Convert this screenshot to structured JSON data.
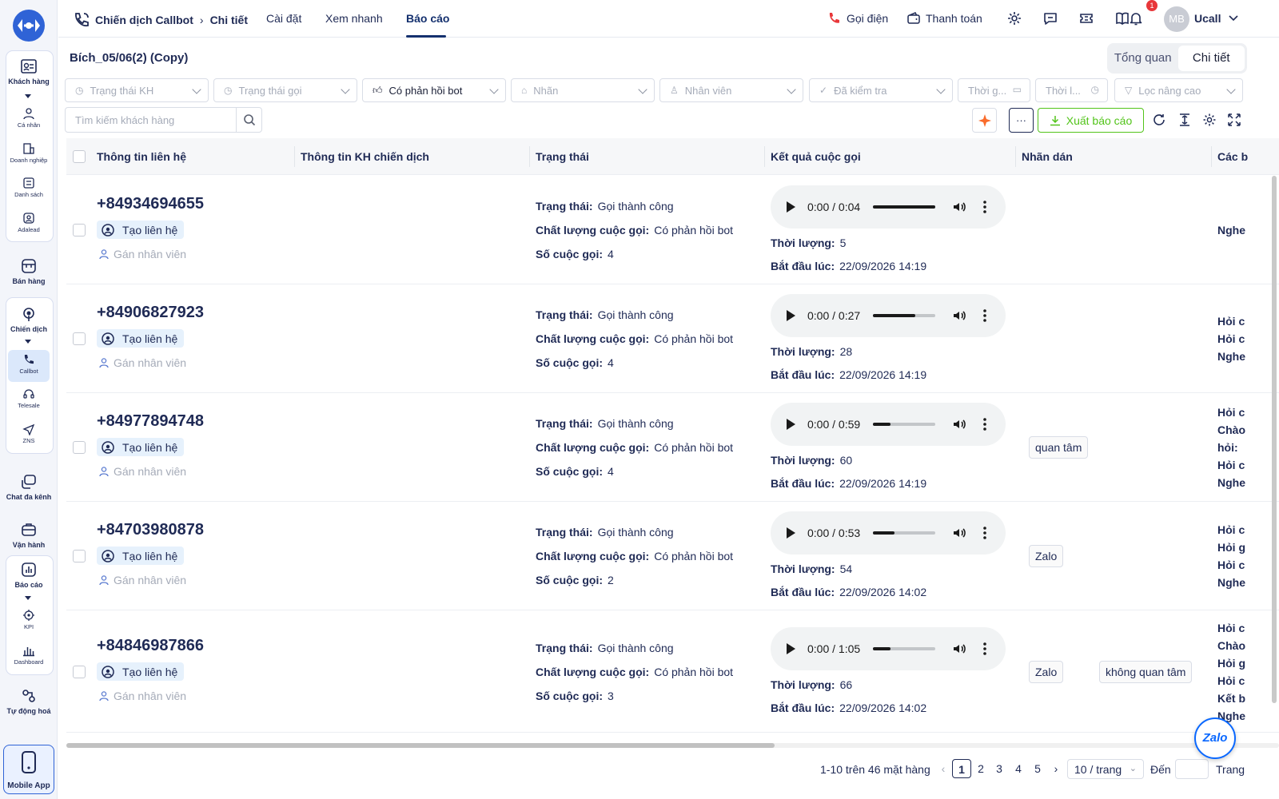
{
  "sidebar": {
    "items": [
      {
        "label": "Khách hàng",
        "icon": "contact-card-icon"
      },
      {
        "label": "Cá nhân",
        "icon": "people-icon"
      },
      {
        "label": "Doanh nghiệp",
        "icon": "building-icon"
      },
      {
        "label": "Danh sách",
        "icon": "list-icon"
      },
      {
        "label": "Adalead",
        "icon": "user-circle-icon"
      },
      {
        "label": "Bán hàng",
        "icon": "store-icon"
      },
      {
        "label": "Chiến dịch",
        "icon": "broadcast-icon"
      },
      {
        "label": "Callbot",
        "icon": "phone-icon"
      },
      {
        "label": "Telesale",
        "icon": "headset-icon"
      },
      {
        "label": "ZNS",
        "icon": "send-icon"
      },
      {
        "label": "Chat đa kênh",
        "icon": "chat-icon"
      },
      {
        "label": "Vận hành",
        "icon": "briefcase-icon"
      },
      {
        "label": "Báo cáo",
        "icon": "chart-icon"
      },
      {
        "label": "KPI",
        "icon": "target-icon"
      },
      {
        "label": "Dashboard",
        "icon": "bars-icon"
      },
      {
        "label": "Tự động hoá",
        "icon": "automation-icon"
      }
    ],
    "mobile_app": "Mobile App"
  },
  "header": {
    "breadcrumb_root": "Chiến dịch Callbot",
    "breadcrumb_current": "Chi tiết",
    "tabs": [
      "Cài đặt",
      "Xem nhanh",
      "Báo cáo"
    ],
    "active_tab": "Báo cáo",
    "call_label": "Gọi điện",
    "pay_label": "Thanh toán",
    "notification_count": "1",
    "avatar_initials": "MB",
    "user_name": "Ucall"
  },
  "page": {
    "title": "Bích_05/06(2) (Copy)",
    "view_toggle": [
      "Tổng quan",
      "Chi tiết"
    ],
    "active_view": "Chi tiết"
  },
  "filters": [
    {
      "label": "Trạng thái KH",
      "placeholder": true
    },
    {
      "label": "Trạng thái gọi",
      "placeholder": true
    },
    {
      "label": "Có phản hồi bot",
      "placeholder": false
    },
    {
      "label": "Nhãn",
      "placeholder": true
    },
    {
      "label": "Nhân viên",
      "placeholder": true
    },
    {
      "label": "Đã kiểm tra",
      "placeholder": true
    },
    {
      "label": "Thời g...",
      "placeholder": true
    },
    {
      "label": "Thời l...",
      "placeholder": true
    },
    {
      "label": "Lọc nâng cao",
      "placeholder": true
    }
  ],
  "toolbar": {
    "search_placeholder": "Tìm kiếm khách hàng",
    "more_label": "···",
    "export_label": "Xuất báo cáo"
  },
  "table": {
    "columns": [
      "Thông tin liên hệ",
      "Thông tin KH chiến dịch",
      "Trạng thái",
      "Kết quả cuộc gọi",
      "Nhãn dán",
      "Các b"
    ],
    "labels": {
      "status": "Trạng thái:",
      "quality": "Chất lượng cuộc gọi:",
      "calls": "Số cuộc gọi:",
      "duration": "Thời lượng:",
      "started": "Bắt đầu lúc:",
      "create_contact": "Tạo liên hệ",
      "assign_staff": "Gán nhân viên"
    },
    "rows": [
      {
        "phone": "+84934694655",
        "status": "Gọi thành công",
        "quality": "Có phản hồi bot",
        "calls": "4",
        "audio_time": "0:00 / 0:04",
        "progress": 1.0,
        "duration": "5",
        "started": "22/09/2026 14:19",
        "tags": [],
        "notes": [
          "Nghe"
        ]
      },
      {
        "phone": "+84906827923",
        "status": "Gọi thành công",
        "quality": "Có phản hồi bot",
        "calls": "4",
        "audio_time": "0:00 / 0:27",
        "progress": 0.68,
        "duration": "28",
        "started": "22/09/2026 14:19",
        "tags": [],
        "notes": [
          "Hỏi c",
          "Hỏi c",
          "Nghe"
        ]
      },
      {
        "phone": "+84977894748",
        "status": "Gọi thành công",
        "quality": "Có phản hồi bot",
        "calls": "4",
        "audio_time": "0:00 / 0:59",
        "progress": 0.28,
        "duration": "60",
        "started": "22/09/2026 14:19",
        "tags": [
          "quan tâm"
        ],
        "notes": [
          "Hỏi c",
          "Chào",
          "hỏi:",
          "Hỏi c",
          "Nghe"
        ]
      },
      {
        "phone": "+84703980878",
        "status": "Gọi thành công",
        "quality": "Có phản hồi bot",
        "calls": "2",
        "audio_time": "0:00 / 0:53",
        "progress": 0.34,
        "duration": "54",
        "started": "22/09/2026 14:02",
        "tags": [
          "Zalo"
        ],
        "notes": [
          "Hỏi c",
          "Hỏi g",
          "Hỏi c",
          "Nghe"
        ]
      },
      {
        "phone": "+84846987866",
        "status": "Gọi thành công",
        "quality": "Có phản hồi bot",
        "calls": "3",
        "audio_time": "0:00 / 1:05",
        "progress": 0.28,
        "duration": "66",
        "started": "22/09/2026 14:02",
        "tags": [
          "Zalo",
          "không quan tâm"
        ],
        "notes": [
          "Hỏi c",
          "Chào",
          "Hỏi g",
          "Hỏi c",
          "Kết b",
          "Nghe"
        ]
      }
    ]
  },
  "pagination": {
    "summary": "1-10 trên 46 mặt hàng",
    "pages": [
      "1",
      "2",
      "3",
      "4",
      "5"
    ],
    "current": "1",
    "page_size": "10 / trang",
    "goto_label": "Đến",
    "page_word": "Trang"
  },
  "zalo_label": "Zalo",
  "colors": {
    "brand": "#1f2a55",
    "accent": "#2f63d6",
    "success": "#52c41a",
    "danger": "#e8373a"
  }
}
